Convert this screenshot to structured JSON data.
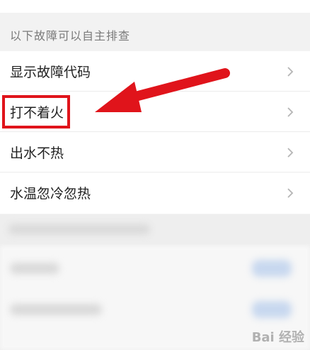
{
  "section": {
    "title": "以下故障可以自主排查"
  },
  "items": [
    {
      "label": "显示故障代码"
    },
    {
      "label": "打不着火"
    },
    {
      "label": "出水不热"
    },
    {
      "label": "水温忽冷忽热"
    }
  ],
  "icons": {
    "row_chevron": "chevron-right-icon",
    "annotation_arrow": "red-arrow-icon"
  },
  "colors": {
    "highlight": "#e0141b",
    "background": "#f2f2f2",
    "row_bg": "#ffffff"
  },
  "watermark": {
    "text": "Bai 经验"
  }
}
